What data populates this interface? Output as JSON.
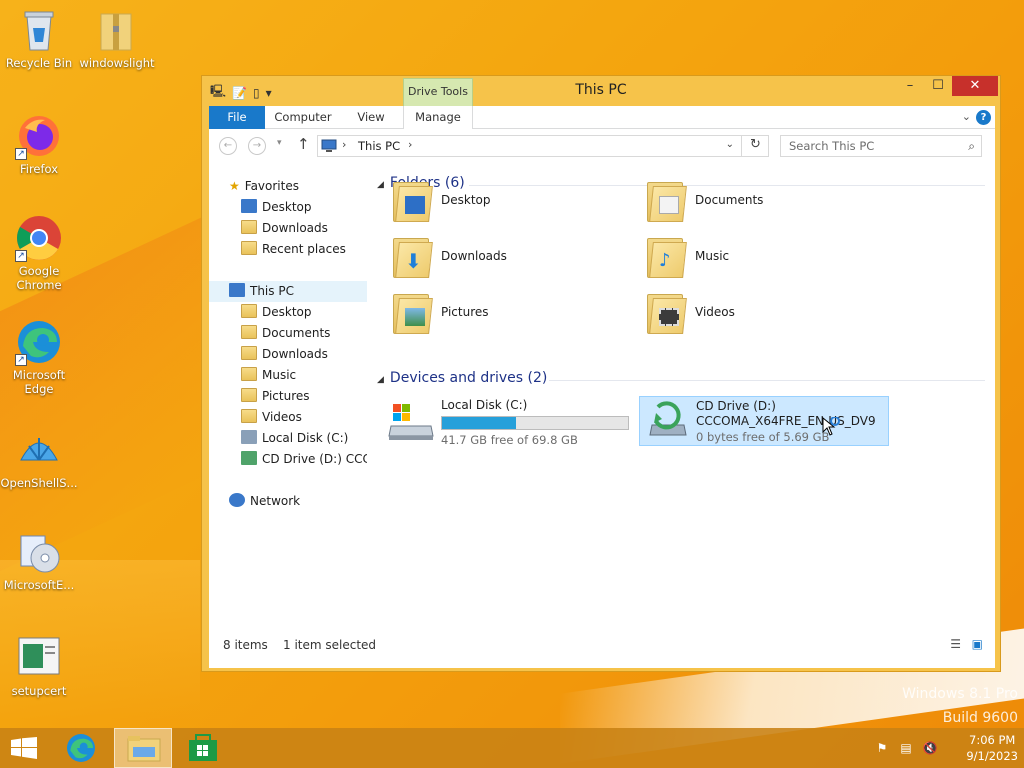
{
  "desktop": {
    "icons": [
      {
        "label": "Recycle Bin"
      },
      {
        "label": "windowslight"
      },
      {
        "label": "Firefox"
      },
      {
        "label": "Google Chrome"
      },
      {
        "label": "Microsoft Edge"
      },
      {
        "label": "OpenShellS..."
      },
      {
        "label": "MicrosoftE..."
      },
      {
        "label": "setupcert"
      }
    ],
    "watermark_line1": "Windows 8.1 Pro",
    "watermark_line2": "Build 9600"
  },
  "window": {
    "title": "This PC",
    "contextual_tab_group": "Drive Tools",
    "controls": {
      "minimize": "–",
      "maximize": "☐",
      "close": "✕"
    }
  },
  "ribbon": {
    "tabs": [
      "File",
      "Computer",
      "View",
      "Manage"
    ],
    "active_color": "#1979ca"
  },
  "navbar": {
    "address_path": "This PC",
    "search_placeholder": "Search This PC"
  },
  "navpane": {
    "favorites_label": "Favorites",
    "favorites": [
      "Desktop",
      "Downloads",
      "Recent places"
    ],
    "thispc_label": "This PC",
    "thispc_items": [
      "Desktop",
      "Documents",
      "Downloads",
      "Music",
      "Pictures",
      "Videos",
      "Local Disk (C:)",
      "CD Drive (D:) CCCOI"
    ],
    "network_label": "Network"
  },
  "folders": {
    "header": "Folders (6)",
    "items": [
      "Desktop",
      "Documents",
      "Downloads",
      "Music",
      "Pictures",
      "Videos"
    ]
  },
  "devices": {
    "header": "Devices and drives (2)",
    "local_disk": {
      "name": "Local Disk (C:)",
      "free_text": "41.7 GB free of 69.8 GB",
      "used_fraction": 0.4
    },
    "cd_drive": {
      "name": "CD Drive (D:)",
      "label": "CCCOMA_X64FRE_EN-US_DV9",
      "free_text": "0 bytes free of 5.69 GB"
    }
  },
  "status": {
    "items": "8 items",
    "selected": "1 item selected"
  },
  "taskbar": {
    "time": "7:06 PM",
    "date": "9/1/2023"
  }
}
